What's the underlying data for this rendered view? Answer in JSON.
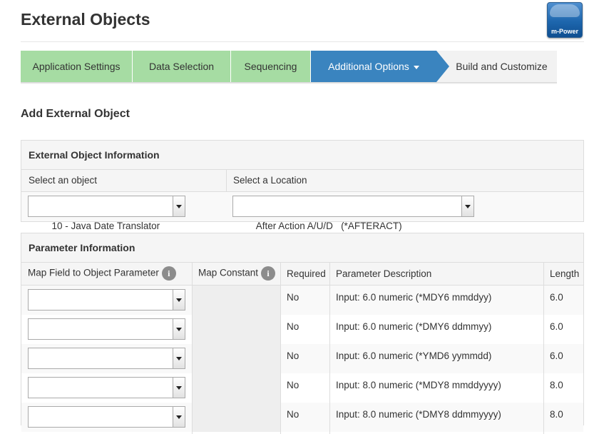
{
  "page": {
    "title": "External Objects"
  },
  "logo": {
    "text": "m-Power"
  },
  "wizard": {
    "steps": [
      {
        "label": "Application Settings"
      },
      {
        "label": "Data Selection"
      },
      {
        "label": "Sequencing"
      },
      {
        "label": "Additional Options"
      },
      {
        "label": "Build and Customize"
      }
    ]
  },
  "section": {
    "title": "Add External Object"
  },
  "object_info": {
    "title": "External Object Information",
    "object_label": "Select an object",
    "location_label": "Select a Location",
    "object_value": "10 - Java Date Translator",
    "location_value": "After Action A/U/D   (*AFTERACT)"
  },
  "params": {
    "title": "Parameter Information",
    "headers": {
      "map_field": "Map Field to Object Parameter",
      "map_constant": "Map Constant",
      "required": "Required",
      "description": "Parameter Description",
      "length": "Length"
    },
    "info_icon": "i",
    "rows": [
      {
        "required": "No",
        "description": "Input: 6.0 numeric (*MDY6 mmddyy)",
        "length": "6.0"
      },
      {
        "required": "No",
        "description": "Input: 6.0 numeric (*DMY6 ddmmyy)",
        "length": "6.0"
      },
      {
        "required": "No",
        "description": "Input: 6.0 numeric (*YMD6 yymmdd)",
        "length": "6.0"
      },
      {
        "required": "No",
        "description": "Input: 8.0 numeric (*MDY8 mmddyyyy)",
        "length": "8.0"
      },
      {
        "required": "No",
        "description": "Input: 8.0 numeric (*DMY8 ddmmyyyy)",
        "length": "8.0"
      }
    ]
  },
  "colors": {
    "step_done": "#a6dca3",
    "step_active": "#3a84bf",
    "step_todo": "#f2f2f2"
  }
}
